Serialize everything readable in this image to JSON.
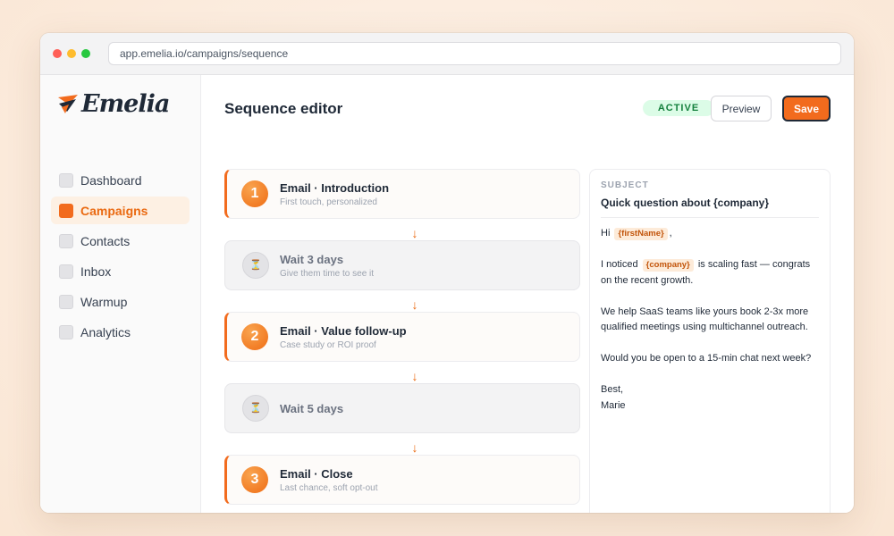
{
  "browser": {
    "url": "app.emelia.io/campaigns/sequence"
  },
  "brand": {
    "name": "Emelia"
  },
  "sidebar": {
    "items": [
      {
        "label": "Dashboard"
      },
      {
        "label": "Campaigns",
        "active": true
      },
      {
        "label": "Contacts"
      },
      {
        "label": "Inbox"
      },
      {
        "label": "Warmup"
      },
      {
        "label": "Analytics"
      }
    ]
  },
  "header": {
    "title": "Sequence editor",
    "status": "ACTIVE",
    "preview_label": "Preview",
    "save_label": "Save"
  },
  "steps": [
    {
      "type": "email",
      "num": "1",
      "title": "Email · Introduction",
      "sub": "First touch, personalized"
    },
    {
      "type": "wait",
      "title": "Wait 3 days",
      "sub": "Give them time to see it"
    },
    {
      "type": "email",
      "num": "2",
      "title": "Email · Value follow-up",
      "sub": "Case study or ROI proof"
    },
    {
      "type": "wait",
      "title": "Wait 5 days",
      "sub": ""
    },
    {
      "type": "email",
      "num": "3",
      "title": "Email · Close",
      "sub": "Last chance, soft opt-out"
    }
  ],
  "arrow_glyph": "↓",
  "wait_glyph": "⏳",
  "preview": {
    "subject_label": "SUBJECT",
    "subject": "Quick question about {company}",
    "greeting": "Hi",
    "var_first_name": "{firstName}",
    "greeting_end": ",",
    "p1_start": "I noticed",
    "var_company": "{company}",
    "p1_end": "is scaling fast — congrats on the recent growth.",
    "p2": "We help SaaS teams like yours book 2-3x more qualified meetings using multichannel outreach.",
    "p3": "Would you be open to a 15-min chat next week?",
    "signoff": "Best,",
    "signature": "Marie"
  },
  "colors": {
    "accent": "#f26b1d",
    "active_bg": "#dcfce7",
    "active_text": "#15803d"
  }
}
